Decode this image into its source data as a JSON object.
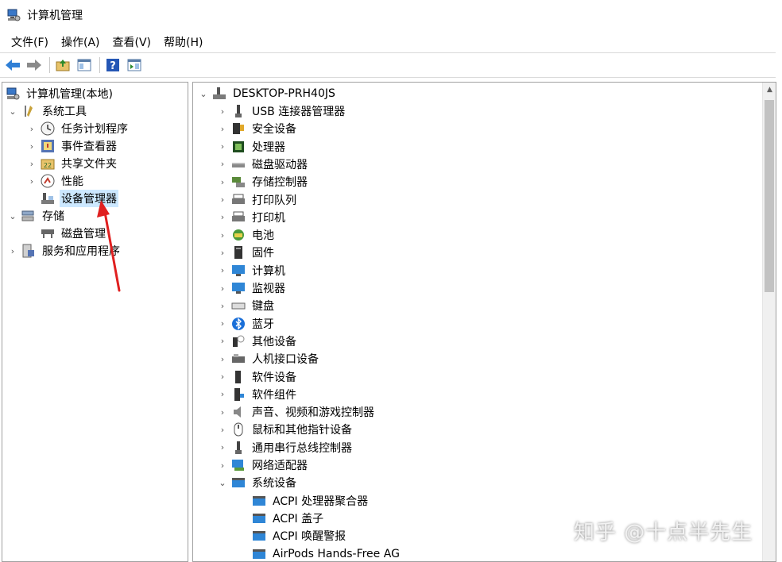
{
  "window": {
    "title": "计算机管理"
  },
  "menu": [
    "文件(F)",
    "操作(A)",
    "查看(V)",
    "帮助(H)"
  ],
  "left_tree": {
    "root": "计算机管理(本地)",
    "system_tools": "系统工具",
    "task_scheduler": "任务计划程序",
    "event_viewer": "事件查看器",
    "shared_folders": "共享文件夹",
    "performance": "性能",
    "device_manager": "设备管理器",
    "storage": "存储",
    "disk_management": "磁盘管理",
    "services_apps": "服务和应用程序"
  },
  "device_tree": {
    "computer_name": "DESKTOP-PRH40JS",
    "categories": [
      "USB 连接器管理器",
      "安全设备",
      "处理器",
      "磁盘驱动器",
      "存储控制器",
      "打印队列",
      "打印机",
      "电池",
      "固件",
      "计算机",
      "监视器",
      "键盘",
      "蓝牙",
      "其他设备",
      "人机接口设备",
      "软件设备",
      "软件组件",
      "声音、视频和游戏控制器",
      "鼠标和其他指针设备",
      "通用串行总线控制器",
      "网络适配器",
      "系统设备"
    ],
    "system_devices": [
      "ACPI 处理器聚合器",
      "ACPI 盖子",
      "ACPI 唤醒警报",
      "AirPods Hands-Free AG"
    ]
  },
  "watermark": "知乎 @十点半先生",
  "colors": {
    "selection": "#cce8ff",
    "arrow": "#e02020"
  }
}
